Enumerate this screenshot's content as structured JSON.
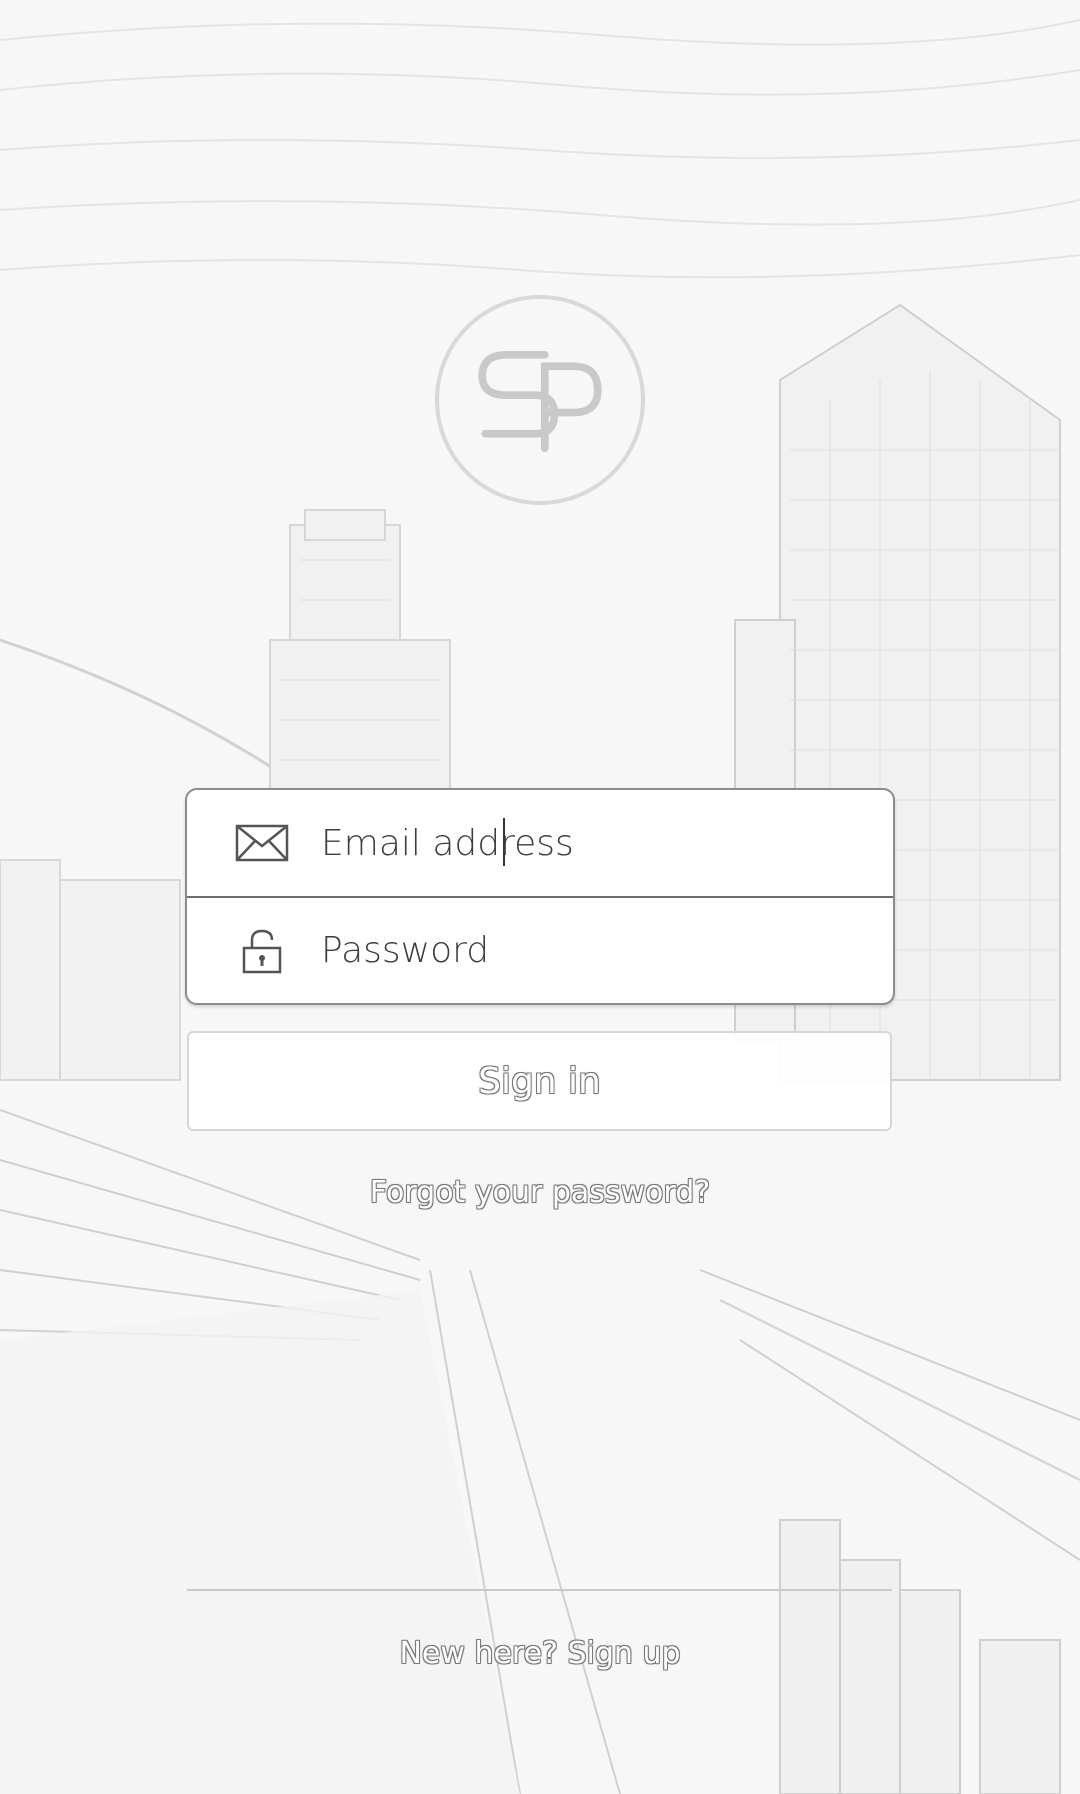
{
  "brand": {
    "logo_text": "SP"
  },
  "login": {
    "email_placeholder": "Email address",
    "password_placeholder": "Password",
    "email_icon": "envelope-icon",
    "password_icon": "lock-icon",
    "sign_in_label": "Sign in",
    "forgot_password_label": "Forgot your password?",
    "signup_label": "New here? Sign up"
  }
}
